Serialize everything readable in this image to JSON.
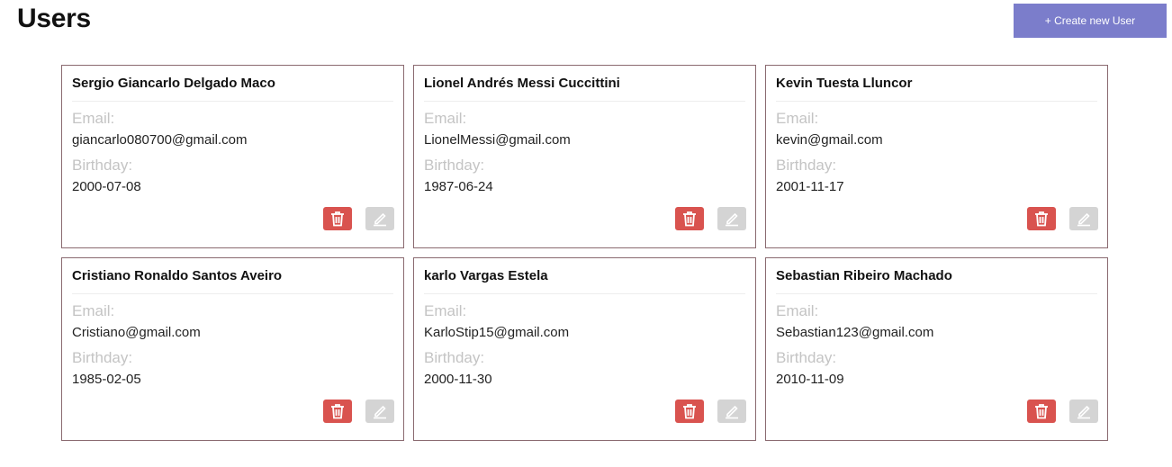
{
  "header": {
    "title": "Users",
    "create_button_label": "+ Create new User"
  },
  "labels": {
    "email": "Email:",
    "birthday": "Birthday:"
  },
  "colors": {
    "accent": "#7b7dcb",
    "delete": "#d9534f",
    "edit": "#d4d4d4",
    "card_border": "#8a6a70"
  },
  "users": [
    {
      "name": "Sergio Giancarlo Delgado Maco",
      "email": "giancarlo080700@gmail.com",
      "birthday": "2000-07-08"
    },
    {
      "name": "Lionel Andrés Messi Cuccittini",
      "email": "LionelMessi@gmail.com",
      "birthday": "1987-06-24"
    },
    {
      "name": "Kevin Tuesta Lluncor",
      "email": "kevin@gmail.com",
      "birthday": "2001-11-17"
    },
    {
      "name": "Cristiano Ronaldo Santos Aveiro",
      "email": "Cristiano@gmail.com",
      "birthday": "1985-02-05"
    },
    {
      "name": "karlo Vargas Estela",
      "email": "KarloStip15@gmail.com",
      "birthday": "2000-11-30"
    },
    {
      "name": "Sebastian Ribeiro Machado",
      "email": "Sebastian123@gmail.com",
      "birthday": "2010-11-09"
    }
  ],
  "icons": {
    "delete": "trash-icon",
    "edit": "pencil-icon"
  }
}
